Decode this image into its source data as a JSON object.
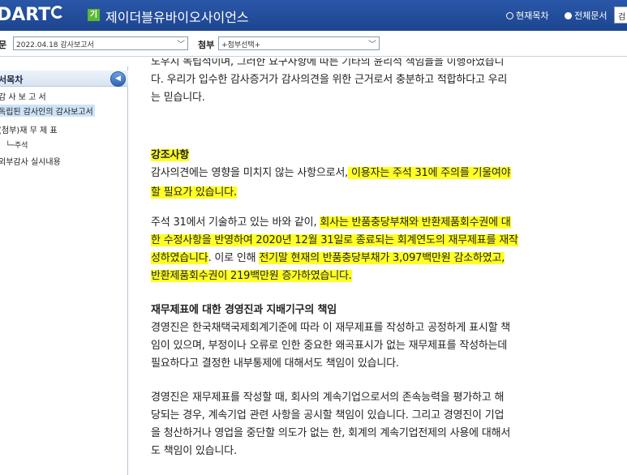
{
  "header": {
    "logo_text": "DART",
    "company_badge": "기",
    "company_name": "제이더블유바이오사이언스",
    "scope_current": "현재목차",
    "scope_all": "전체문서",
    "search_value": "검"
  },
  "toolbar": {
    "report_label": "문",
    "report_value": "2022.04.18  감사보고서",
    "attach_label": "첨부",
    "attach_value": "+첨부선택+"
  },
  "sidebar": {
    "title": "서목차",
    "items": [
      {
        "label": "감 사 보 고 서"
      },
      {
        "label": "독립된 감사인의 감사보고서"
      },
      {
        "label": "(첨부)재 무 제 표"
      },
      {
        "label": "└─주석"
      },
      {
        "label": "외부감사 실시내용"
      }
    ]
  },
  "document": {
    "top_lines": [
      "도우지 독립적이며, 그러한 요구사항에 따른 기타의 윤리적 책임들을 이행하였습니",
      "다. 우리가 입수한 감사증거가 감사의견을 위한 근거로서 충분하고 적합하다고 우리",
      "는 믿습니다."
    ],
    "emphasis": {
      "heading": "강조사항",
      "line1_plain": "감사의견에는 영향을 미치지 않는 사항으로서,",
      "line1_hl": " 이용자는 주석 31에 주의를 기울여야",
      "line2_hl": "할 필요가 있습니다."
    },
    "note_para": {
      "l1_plain": "주석 31에서 기술하고 있는 바와 같이, ",
      "l1_hl": "회사는 반품충당부채와 반환제품회수권에 대",
      "l2_hl": "한 수정사항을 반영하여 2020년 12월 31일로 종료되는 회계연도의 재무제표를 재작",
      "l3_hl1": "성하였습니다",
      "l3_plain": ". 이로 인해 ",
      "l3_hl2": "전기말 현재의 반품충당부채가 3,097백만원 감소하였고,",
      "l4_hl": "반환제품회수권이 219백만원 증가하였습니다."
    },
    "responsibility": {
      "heading": "재무제표에 대한 경영진과 지배기구의 책임",
      "para1": [
        "경영진은 한국채택국제회계기준에 따라 이 재무제표를 작성하고 공정하게 표시할 책",
        "임이 있으며, 부정이나 오류로 인한 중요한 왜곡표시가 없는 재무제표를 작성하는데",
        "필요하다고 결정한 내부통제에 대해서도 책임이 있습니다."
      ],
      "para2": [
        "경영진은 재무제표를 작성할 때, 회사의 계속기업으로서의 존속능력을 평가하고 해",
        "당되는 경우, 계속기업 관련 사항을 공시할 책임이 있습니다. 그리고 경영진이 기업",
        "을 청산하거나 영업을 중단할 의도가 없는 한, 회계의 계속기업전제의 사용에 대해서",
        "도 책임이 있습니다."
      ]
    }
  },
  "colors": {
    "header_blue": "#1d4590",
    "highlight_yellow": "#ffff24",
    "badge_green": "#5cb832",
    "sidebar_selected": "#cde3f7"
  },
  "icons": {
    "logo": "dart-logo-swoosh",
    "collapse": "chevron-left-icon",
    "chevron": "chevron-down-icon",
    "radio_current": "radio-empty-icon",
    "radio_all": "radio-filled-icon"
  }
}
